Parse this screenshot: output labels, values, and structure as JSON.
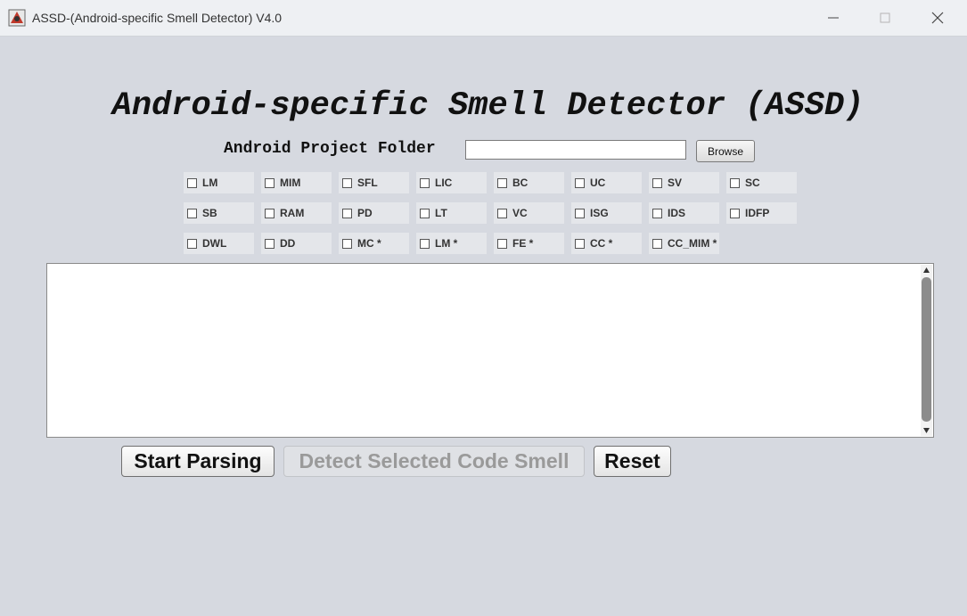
{
  "window": {
    "title": "ASSD-(Android-specific Smell Detector) V4.0",
    "app_icon": "android-app-icon"
  },
  "header": {
    "heading": "Android-specific Smell Detector (ASSD)"
  },
  "folder": {
    "label": "Android Project Folder",
    "value": "",
    "browse_label": "Browse"
  },
  "smells": {
    "row1": [
      "LM",
      "MIM",
      "SFL",
      "LIC",
      "BC",
      "UC",
      "SV",
      "SC"
    ],
    "row2": [
      "SB",
      "RAM",
      "PD",
      "LT",
      "VC",
      "ISG",
      "IDS",
      "IDFP"
    ],
    "row3": [
      "DWL",
      "DD",
      "MC *",
      "LM *",
      "FE *",
      "CC *",
      "CC_MIM *"
    ]
  },
  "output": {
    "text": ""
  },
  "buttons": {
    "start": "Start Parsing",
    "detect": "Detect Selected Code Smell",
    "reset": "Reset"
  },
  "colors": {
    "background": "#d6d9e0",
    "disabled_text": "#9a9a9a"
  }
}
